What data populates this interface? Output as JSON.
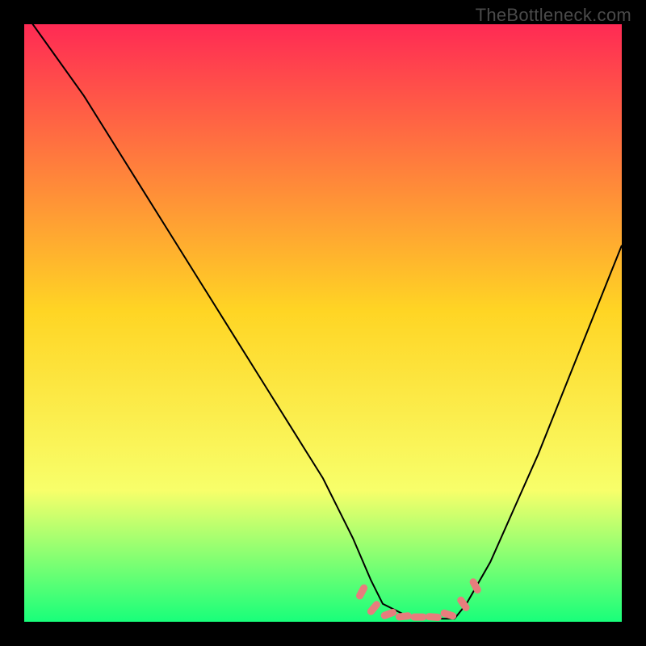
{
  "watermark": "TheBottleneck.com",
  "colors": {
    "bg": "#000000",
    "grad_top": "#ff2a54",
    "grad_mid": "#ffd524",
    "grad_low": "#f8ff6a",
    "grad_bottom": "#18ff7a",
    "curve": "#000000",
    "marker": "#e77d7d",
    "marker_stroke": "#c85a5a"
  },
  "chart_data": {
    "type": "line",
    "title": "",
    "xlabel": "",
    "ylabel": "",
    "xlim": [
      0,
      100
    ],
    "ylim": [
      0,
      100
    ],
    "series": [
      {
        "name": "curve",
        "x": [
          0,
          5,
          10,
          15,
          20,
          25,
          30,
          35,
          40,
          45,
          50,
          55,
          58,
          60,
          64,
          68,
          72,
          74,
          78,
          82,
          86,
          90,
          94,
          98,
          100
        ],
        "values": [
          102,
          95,
          88,
          80,
          72,
          64,
          56,
          48,
          40,
          32,
          24,
          14,
          7,
          3,
          1,
          0.5,
          0.5,
          3,
          10,
          19,
          28,
          38,
          48,
          58,
          63
        ]
      }
    ],
    "markers": [
      {
        "x": 56.5,
        "y": 5.0,
        "angle": -62
      },
      {
        "x": 58.5,
        "y": 2.3,
        "angle": -50
      },
      {
        "x": 61.0,
        "y": 1.3,
        "angle": -20
      },
      {
        "x": 63.5,
        "y": 0.9,
        "angle": -6
      },
      {
        "x": 66.0,
        "y": 0.8,
        "angle": 0
      },
      {
        "x": 68.5,
        "y": 0.8,
        "angle": 4
      },
      {
        "x": 71.0,
        "y": 1.2,
        "angle": 18
      },
      {
        "x": 73.5,
        "y": 3.0,
        "angle": 55
      },
      {
        "x": 75.5,
        "y": 6.0,
        "angle": 62
      }
    ]
  }
}
